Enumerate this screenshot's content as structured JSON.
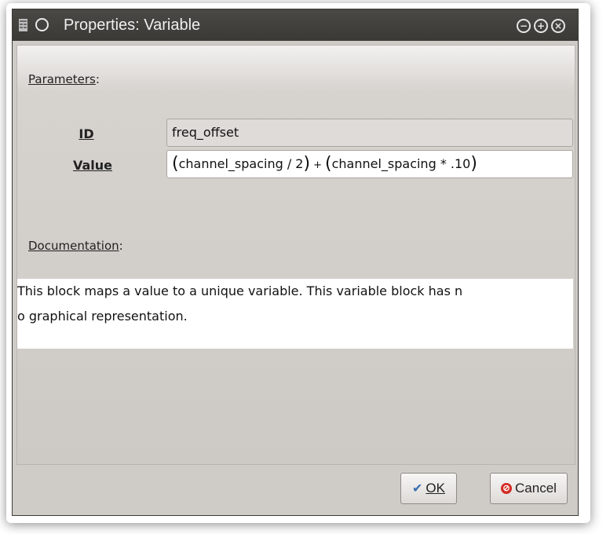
{
  "window": {
    "title": "Properties: Variable",
    "buttons": [
      "minimize",
      "maximize",
      "close"
    ]
  },
  "parameters": {
    "section_label": "Parameters",
    "id": {
      "label": "ID",
      "value": "freq_offset"
    },
    "value": {
      "label": "Value",
      "parts": [
        "(",
        "channel_spacing / 2",
        ")",
        "+",
        "(",
        "channel_spacing * .10",
        ")"
      ]
    }
  },
  "documentation": {
    "section_label": "Documentation",
    "lines": [
      "This block maps a value to a unique variable. This variable block has n",
      "o graphical representation."
    ]
  },
  "actions": {
    "ok_label": "OK",
    "cancel_label": "Cancel"
  },
  "icons": {
    "window_menu": "circle-icon",
    "ok": "check-icon",
    "cancel": "cancel-icon"
  }
}
